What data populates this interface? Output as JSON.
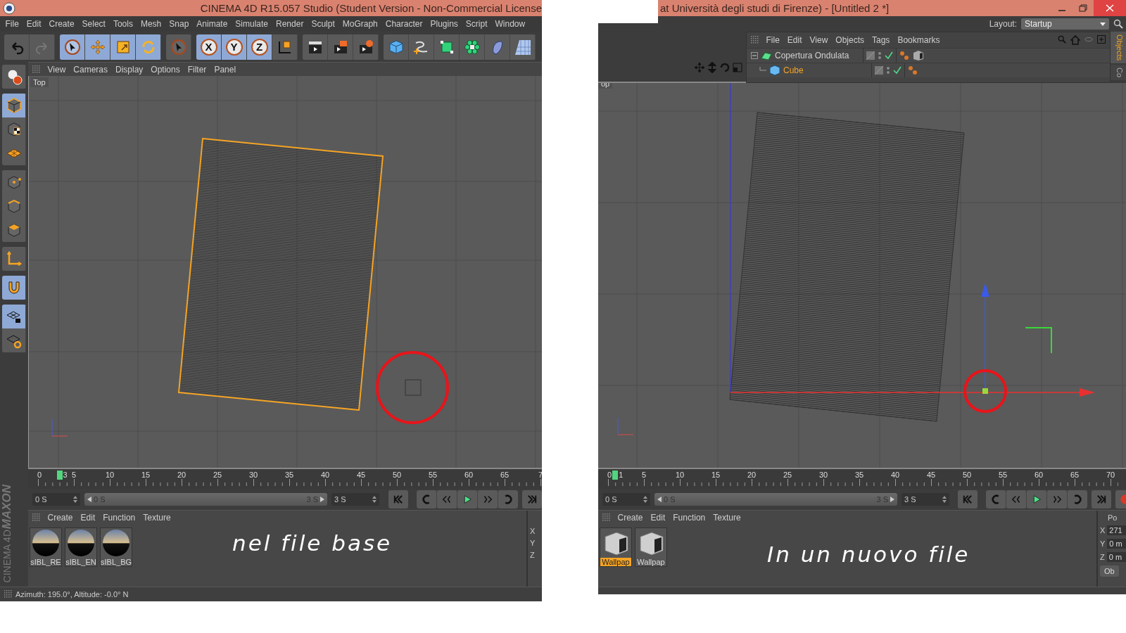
{
  "left_window": {
    "title": "CINEMA 4D R15.057 Studio (Student Version - Non-Commercial License",
    "menu": [
      "File",
      "Edit",
      "Create",
      "Select",
      "Tools",
      "Mesh",
      "Snap",
      "Animate",
      "Simulate",
      "Render",
      "Sculpt",
      "MoGraph",
      "Character",
      "Plugins",
      "Script",
      "Window"
    ],
    "toolbar": [
      [
        {
          "kind": "undo",
          "selected": false
        },
        {
          "kind": "redo",
          "selected": false
        }
      ],
      [
        {
          "kind": "cursor",
          "selected": true
        },
        {
          "kind": "move",
          "selected": true
        },
        {
          "kind": "scale",
          "selected": true
        },
        {
          "kind": "rotate",
          "selected": true
        }
      ],
      [
        {
          "kind": "live-select",
          "selected": false
        }
      ],
      [
        {
          "kind": "axis-lock",
          "label": "X",
          "selected": true
        },
        {
          "kind": "axis-lock",
          "label": "Y",
          "selected": true
        },
        {
          "kind": "axis-lock",
          "label": "Z",
          "selected": true
        },
        {
          "kind": "coord-system",
          "selected": false
        }
      ],
      [
        {
          "kind": "render-view",
          "selected": false
        },
        {
          "kind": "render-picture",
          "selected": false
        },
        {
          "kind": "render-settings",
          "selected": false
        }
      ],
      [
        {
          "kind": "cube",
          "selected": false
        },
        {
          "kind": "pen",
          "selected": false
        },
        {
          "kind": "subdivision",
          "selected": false
        },
        {
          "kind": "cloner",
          "selected": false
        },
        {
          "kind": "deformer",
          "selected": false
        },
        {
          "kind": "floor",
          "selected": false
        }
      ]
    ],
    "palette": [
      [
        {
          "kind": "make-editable",
          "selected": false
        }
      ],
      [
        {
          "kind": "model",
          "selected": true
        },
        {
          "kind": "texture",
          "selected": false
        },
        {
          "kind": "workplane",
          "selected": false
        }
      ],
      [
        {
          "kind": "points",
          "selected": false
        },
        {
          "kind": "edges",
          "selected": false
        },
        {
          "kind": "polygons",
          "selected": false
        }
      ],
      [
        {
          "kind": "axis",
          "selected": false
        }
      ],
      [
        {
          "kind": "magnet",
          "selected": true
        }
      ],
      [
        {
          "kind": "lock-grid",
          "selected": true
        },
        {
          "kind": "grid-cycle",
          "selected": false
        }
      ]
    ],
    "brand": [
      "MAXON",
      "CINEMA 4D"
    ],
    "viewport": {
      "menu": [
        "View",
        "Cameras",
        "Display",
        "Options",
        "Filter",
        "Panel"
      ],
      "label": "Top"
    },
    "timeline": {
      "ticks": [
        "0",
        "5",
        "10",
        "15",
        "20",
        "25",
        "30",
        "35",
        "40",
        "45",
        "50",
        "55",
        "60",
        "65",
        "7"
      ],
      "current": "3"
    },
    "playback": {
      "start": "0 S",
      "range_start": "0 S",
      "range_end": "3 S",
      "end": "3 S",
      "level": 1
    },
    "materials": {
      "menu": [
        "Create",
        "Edit",
        "Function",
        "Texture"
      ],
      "items": [
        {
          "name": "sIBL_RE",
          "kind": "sphere",
          "selected": false
        },
        {
          "name": "sIBL_EN",
          "kind": "sphere",
          "selected": false
        },
        {
          "name": "sIBL_BG",
          "kind": "sphere",
          "selected": false
        }
      ]
    },
    "caption": "nel file base",
    "coordinates": {
      "labels": [
        "X",
        "Y",
        "Z"
      ]
    },
    "status_bar": "Azimuth: 195.0°, Altitude: -0.0°  N"
  },
  "right_window": {
    "title": "at Università degli studi di Firenze) - [Untitled 2 *]",
    "layout": {
      "label": "Layout:",
      "value": "Startup"
    },
    "object_manager": {
      "menu": [
        "File",
        "Edit",
        "View",
        "Objects",
        "Tags",
        "Bookmarks"
      ],
      "objects": [
        {
          "name": "Copertura Ondulata",
          "selected": false,
          "expanded": true,
          "children": [
            {
              "name": "Cube",
              "selected": true
            }
          ]
        }
      ],
      "side_tabs": [
        {
          "label": "Objects",
          "selected": true
        },
        {
          "label": "Co",
          "selected": false
        }
      ]
    },
    "viewport": {
      "label": "op"
    },
    "timeline": {
      "ticks": [
        "0",
        "5",
        "10",
        "15",
        "20",
        "25",
        "30",
        "35",
        "40",
        "45",
        "50",
        "55",
        "60",
        "65",
        "70"
      ],
      "current": "1"
    },
    "playback": {
      "start": "0 S",
      "range_start": "0 S",
      "range_end": "3 S",
      "end": "3 S",
      "level": 1
    },
    "materials": {
      "menu": [
        "Create",
        "Edit",
        "Function",
        "Texture"
      ],
      "items": [
        {
          "name": "Wallpap",
          "kind": "cube",
          "selected": true
        },
        {
          "name": "Wallpap",
          "kind": "cube",
          "selected": false
        }
      ]
    },
    "caption": "In un nuovo file",
    "coordinates": {
      "header": "Po",
      "rows": [
        {
          "label": "X",
          "value": "271"
        },
        {
          "label": "Y",
          "value": "0 m"
        },
        {
          "label": "Z",
          "value": "0 m"
        }
      ],
      "button": "Ob"
    }
  }
}
